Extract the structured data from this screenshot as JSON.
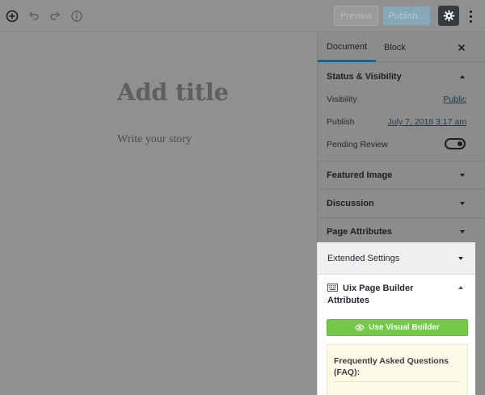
{
  "toolbar": {
    "icons": [
      "add-block-icon",
      "undo-icon",
      "redo-icon",
      "info-icon"
    ],
    "preview_label": "Preview",
    "publish_label": "Publish...",
    "settings_icon": "gear-icon",
    "more_icon": "more-vertical-icon"
  },
  "editor": {
    "title_placeholder": "Add title",
    "body_placeholder": "Write your story"
  },
  "sidebar": {
    "tabs": {
      "document": "Document",
      "block": "Block"
    },
    "status_visibility": {
      "heading": "Status & Visibility",
      "visibility_label": "Visibility",
      "visibility_value": "Public",
      "publish_label": "Publish",
      "publish_value": "July 7, 2018 3:17 am",
      "pending_label": "Pending Review",
      "pending_enabled": true
    },
    "panels": [
      "Featured Image",
      "Discussion",
      "Page Attributes"
    ],
    "extended_settings": "Extended Settings",
    "uix": {
      "title": "Uix Page Builder Attributes",
      "visual_builder_button": "Use Visual Builder",
      "faq_heading": "Frequently Asked Questions (FAQ):"
    }
  },
  "colors": {
    "accent_tab": "#1d5f85",
    "visual_builder_green": "#75c94a",
    "faq_background": "#fefbe9"
  }
}
